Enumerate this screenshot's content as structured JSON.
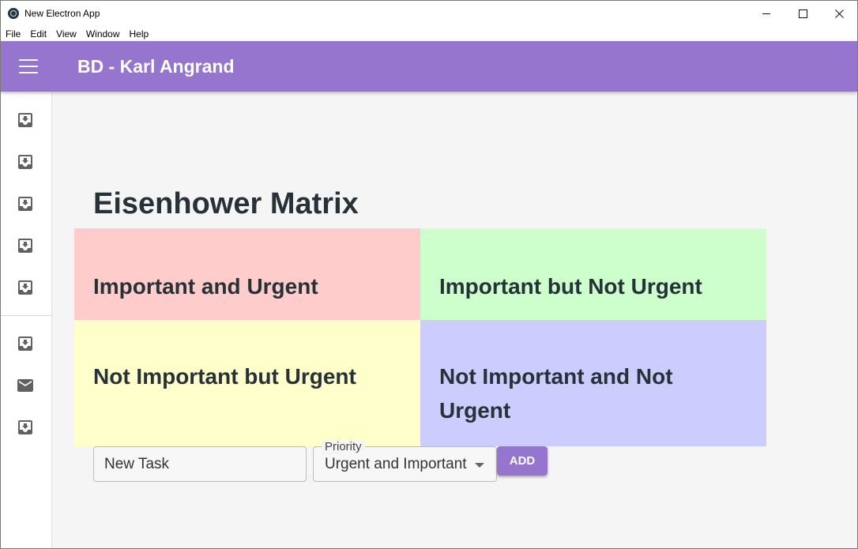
{
  "window": {
    "title": "New Electron App",
    "controls": {
      "minimize": "—",
      "maximize": "☐",
      "close": "✕"
    }
  },
  "menubar": {
    "items": [
      "File",
      "Edit",
      "View",
      "Window",
      "Help"
    ]
  },
  "appbar": {
    "title": "BD - Karl Angrand",
    "menu_icon": "hamburger-menu-icon"
  },
  "sidebar": {
    "group1_icons": [
      "move-to-inbox-icon",
      "move-to-inbox-icon",
      "move-to-inbox-icon",
      "move-to-inbox-icon",
      "move-to-inbox-icon"
    ],
    "group2_icons": [
      "move-to-inbox-icon",
      "mail-icon",
      "move-to-inbox-icon"
    ]
  },
  "main": {
    "title": "Eisenhower Matrix",
    "quadrants": [
      {
        "label": "Important and Urgent",
        "color": "#ffcccc"
      },
      {
        "label": "Important but Not Urgent",
        "color": "#ccffcc"
      },
      {
        "label": "Not Important but Urgent",
        "color": "#ffffcc"
      },
      {
        "label": "Not Important and Not Urgent",
        "color": "#ccccff"
      }
    ]
  },
  "form": {
    "task_value": "New Task",
    "priority_label": "Priority",
    "priority_value": "Urgent and Important",
    "add_label": "ADD"
  },
  "colors": {
    "accent": "#9575cd",
    "background": "#f5f5f5",
    "text": "#263238"
  }
}
